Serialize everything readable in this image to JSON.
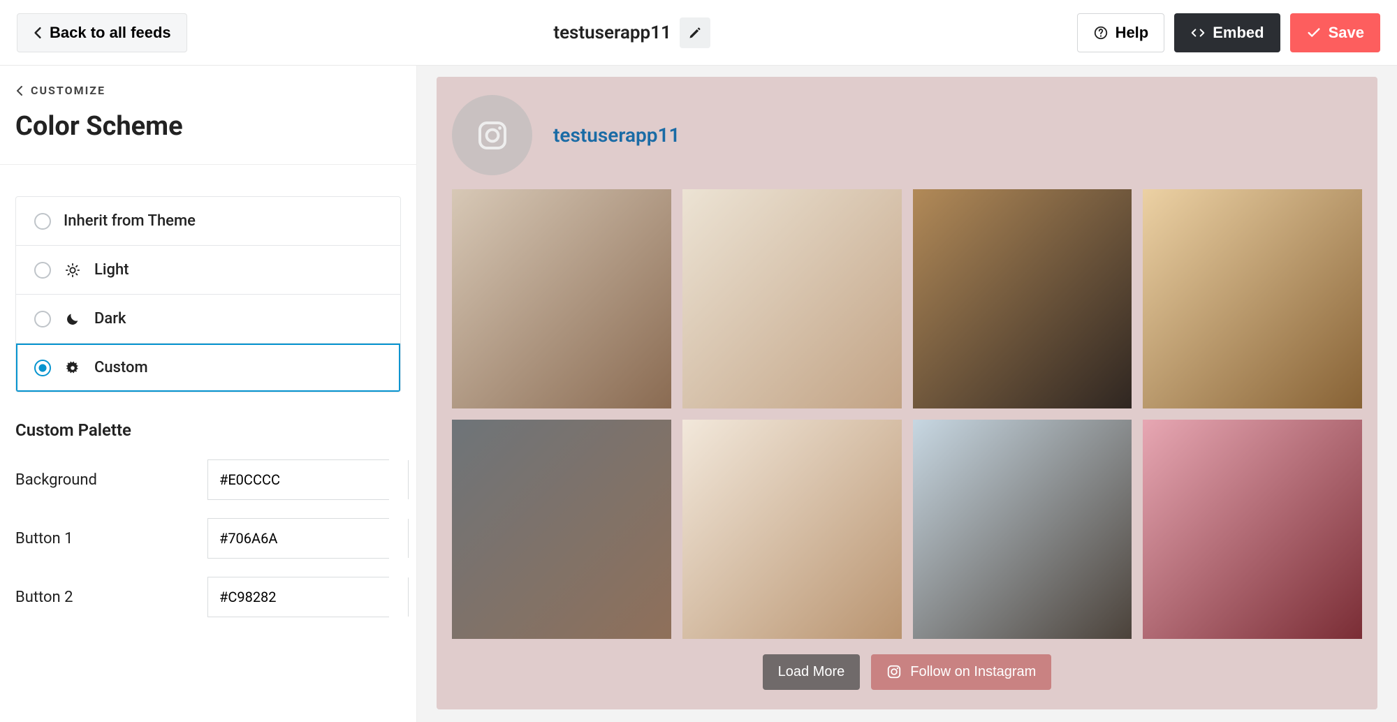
{
  "topbar": {
    "back_label": "Back to all feeds",
    "feed_name": "testuserapp11",
    "help_label": "Help",
    "embed_label": "Embed",
    "save_label": "Save"
  },
  "sidebar": {
    "breadcrumb": "CUSTOMIZE",
    "title": "Color Scheme",
    "options": [
      {
        "label": "Inherit from Theme"
      },
      {
        "label": "Light"
      },
      {
        "label": "Dark"
      },
      {
        "label": "Custom"
      }
    ],
    "selected_index": 3,
    "palette_title": "Custom Palette",
    "palette": {
      "background": {
        "label": "Background",
        "value": "#E0CCCC"
      },
      "button1": {
        "label": "Button 1",
        "value": "#706A6A"
      },
      "button2": {
        "label": "Button 2",
        "value": "#C98282"
      }
    }
  },
  "preview": {
    "username": "testuserapp11",
    "load_more": "Load More",
    "follow": "Follow on Instagram"
  }
}
